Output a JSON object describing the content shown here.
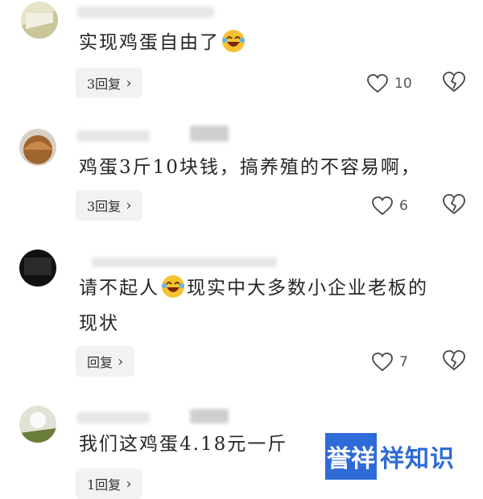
{
  "comments": [
    {
      "text": "实现鸡蛋自由了",
      "emoji": "laughing-crying-emoji",
      "reply": "3回复",
      "likes": "10"
    },
    {
      "text": "鸡蛋3斤10块钱，搞养殖的不容易啊，",
      "reply": "3回复",
      "likes": "6"
    },
    {
      "text_line1_a": "请不起人",
      "emoji": "laughing-crying-emoji",
      "text_line1_b": "现实中大多数小企业老板的",
      "text_line2": "现状",
      "reply": "回复",
      "likes": "7"
    },
    {
      "text": "我们这鸡蛋4.18元一斤",
      "reply": "1回复"
    }
  ],
  "reply_chevron": "›",
  "watermark": {
    "box": "誉祥",
    "text": "祥知识"
  },
  "colors": {
    "watermark": "#2e6bd6",
    "reply_bg": "#f2f2f2"
  }
}
